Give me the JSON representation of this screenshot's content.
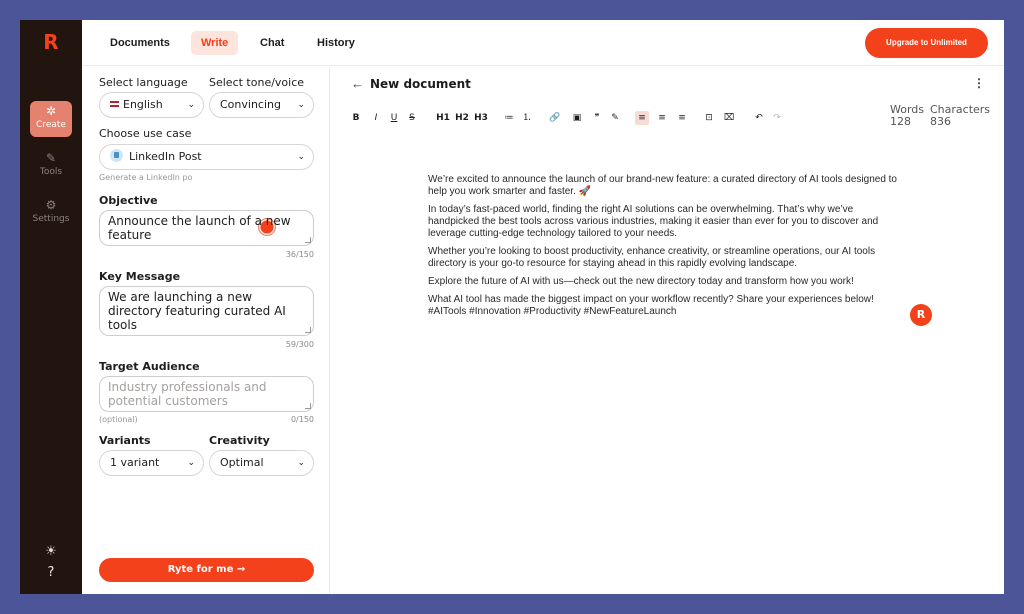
{
  "app": {
    "logo": "R"
  },
  "rail": {
    "items": [
      {
        "label": "Create",
        "icon": "✲"
      },
      {
        "label": "Tools",
        "icon": "✎"
      },
      {
        "label": "Settings",
        "icon": "⚙"
      }
    ],
    "bottom_icons": [
      "sun-icon",
      "help-icon"
    ]
  },
  "nav": {
    "tabs": [
      "Documents",
      "Write",
      "Chat",
      "History"
    ],
    "active_tab": "Write",
    "upgrade_label": "Upgrade to Unlimited"
  },
  "panel": {
    "language_label": "Select language",
    "language_value": "English",
    "tone_label": "Select tone/voice",
    "tone_value": "Convincing",
    "usecase_label": "Choose use case",
    "usecase_value": "LinkedIn Post",
    "usecase_hint": "Generate a LinkedIn po",
    "objective_label": "Objective",
    "objective_value": "Announce the launch of a new feature",
    "objective_count": "36/150",
    "keymessage_label": "Key Message",
    "keymessage_value": "We are launching a new directory featuring curated AI tools",
    "keymessage_count": "59/300",
    "audience_label": "Target Audience",
    "audience_placeholder": "Industry professionals and potential customers",
    "audience_optional": "(optional)",
    "audience_count": "0/150",
    "variants_label": "Variants",
    "variants_value": "1 variant",
    "creativity_label": "Creativity",
    "creativity_value": "Optimal",
    "submit_label": "Ryte for me →"
  },
  "editor": {
    "title": "New document",
    "toolbar": [
      "B",
      "I",
      "U",
      "S",
      "H1",
      "H2",
      "H3",
      "≔",
      "⒈",
      "🔗",
      "▣",
      "❞",
      "✎",
      "≡",
      "≡",
      "≡",
      "⊡",
      "⌧",
      "↶",
      "↷"
    ],
    "words_label": "Words",
    "words_value": "128",
    "chars_label": "Characters",
    "chars_value": "836",
    "paragraphs": [
      "We’re excited to announce the launch of our brand-new feature: a curated directory of AI tools designed to help you work smarter and faster. 🚀",
      "In today’s fast-paced world, finding the right AI solutions can be overwhelming. That’s why we’ve handpicked the best tools across various industries, making it easier than ever for you to discover and leverage cutting-edge technology tailored to your needs.",
      "Whether you’re looking to boost productivity, enhance creativity, or streamline operations, our AI tools directory is your go-to resource for staying ahead in this rapidly evolving landscape.",
      "Explore the future of AI with us—check out the new directory today and transform how you work!",
      "What AI tool has made the biggest impact on your workflow recently? Share your experiences below! #AITools #Innovation #Productivity #NewFeatureLaunch"
    ],
    "badge": "R"
  }
}
